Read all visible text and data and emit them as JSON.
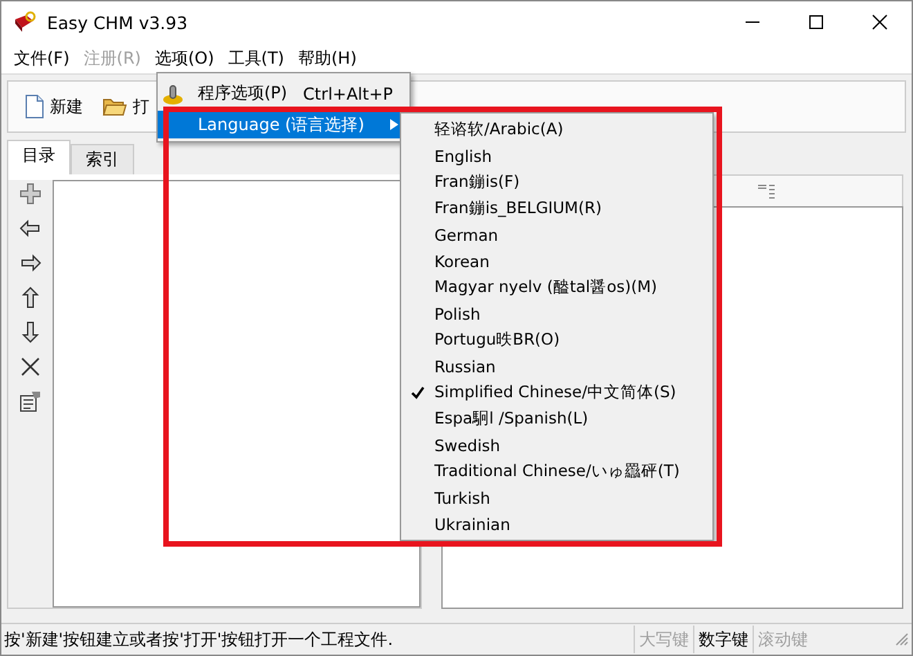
{
  "window": {
    "title": "Easy CHM v3.93"
  },
  "menu_bar": [
    {
      "label": "文件(F)",
      "disabled": false
    },
    {
      "label": "注册(R)",
      "disabled": true
    },
    {
      "label": "选项(O)",
      "disabled": false
    },
    {
      "label": "工具(T)",
      "disabled": false
    },
    {
      "label": "帮助(H)",
      "disabled": false
    }
  ],
  "toolbar": [
    {
      "label": "新建",
      "kind": "new"
    },
    {
      "label": "打",
      "kind": "open"
    }
  ],
  "left_panel": {
    "tabs": [
      {
        "label": "目录",
        "selected": true
      },
      {
        "label": "索引",
        "selected": false
      }
    ]
  },
  "options_menu": [
    {
      "label": "程序选项(P)",
      "shortcut": "Ctrl+Alt+P",
      "selected": false,
      "has_submenu": false
    },
    {
      "label": "Language (语言选择)",
      "selected": true,
      "has_submenu": true
    }
  ],
  "language_menu": [
    {
      "label": "轻谘软/Arabic(A)",
      "checked": false
    },
    {
      "label": "English",
      "checked": false
    },
    {
      "label": "Fran鏰is(F)",
      "checked": false
    },
    {
      "label": "Fran鏰is_BELGIUM(R)",
      "checked": false
    },
    {
      "label": "German",
      "checked": false
    },
    {
      "label": "Korean",
      "checked": false
    },
    {
      "label": "Magyar nyelv (醠tal醤os)(M)",
      "checked": false
    },
    {
      "label": "Polish",
      "checked": false
    },
    {
      "label": "Portugu昳BR(O)",
      "checked": false
    },
    {
      "label": "Russian",
      "checked": false
    },
    {
      "label": "Simplified Chinese/中文简体(S)",
      "checked": true
    },
    {
      "label": "Espa駉l /Spanish(L)",
      "checked": false
    },
    {
      "label": "Swedish",
      "checked": false
    },
    {
      "label": "Traditional Chinese/いゅ羉砰(T)",
      "checked": false
    },
    {
      "label": "Turkish",
      "checked": false
    },
    {
      "label": "Ukrainian",
      "checked": false
    }
  ],
  "status_bar": {
    "message": "按'新建'按钮建立或者按'打开'按钮打开一个工程文件.",
    "indicators": [
      {
        "label": "大写键",
        "enabled": false
      },
      {
        "label": "数字键",
        "enabled": true
      },
      {
        "label": "滚动键",
        "enabled": false
      }
    ]
  }
}
